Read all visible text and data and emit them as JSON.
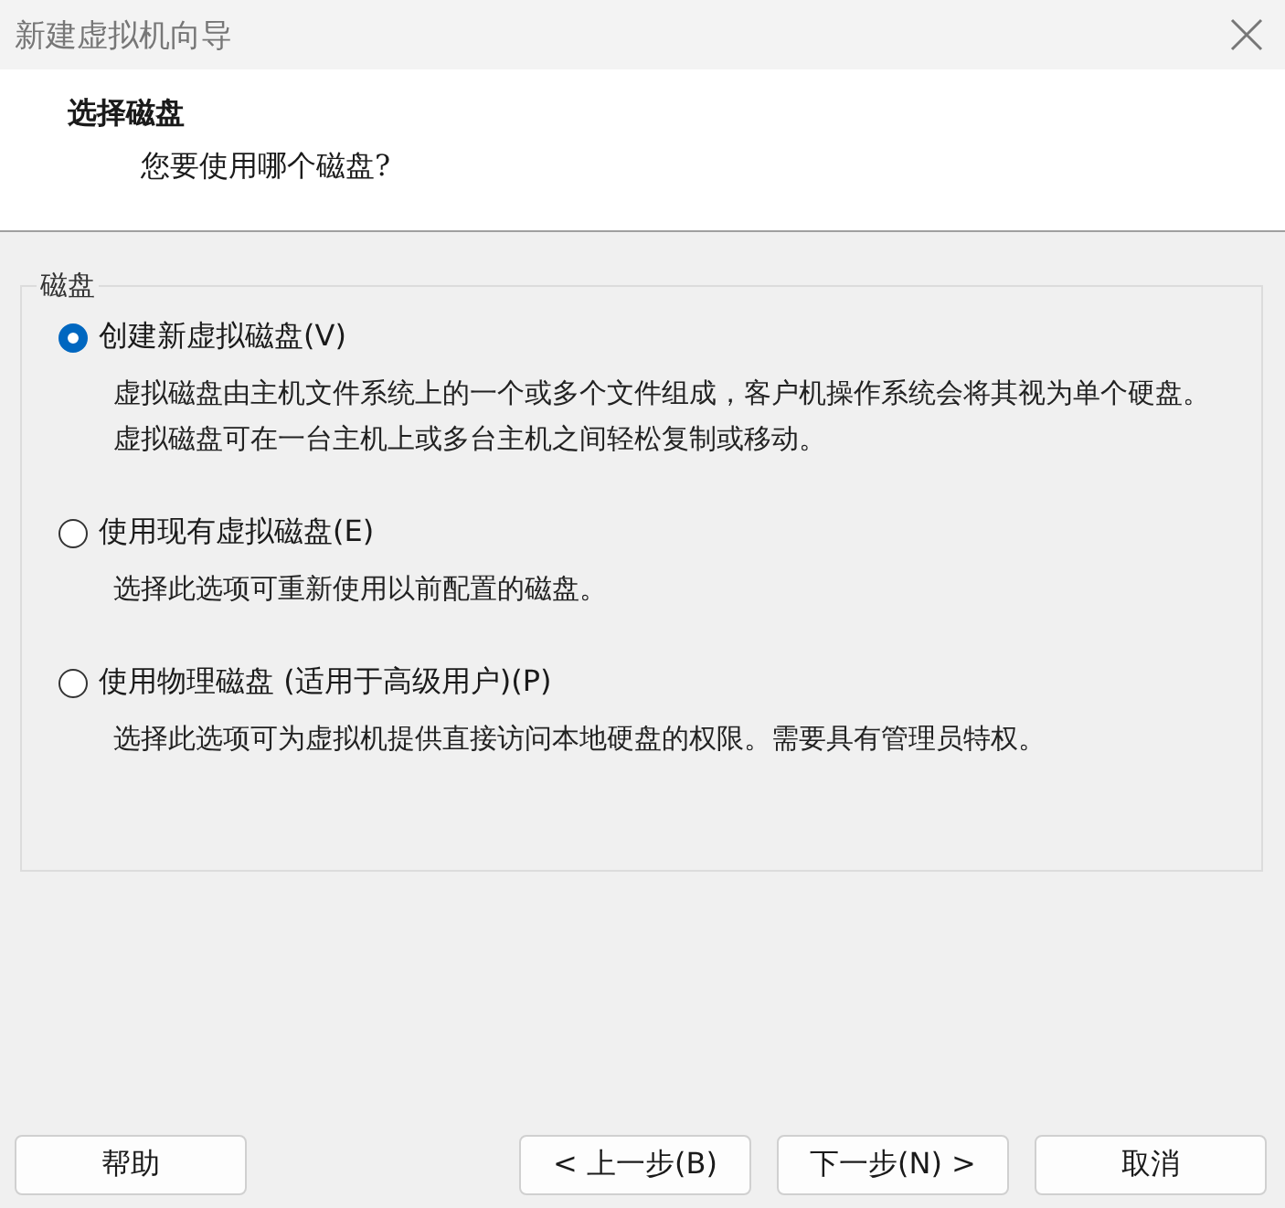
{
  "window": {
    "title": "新建虚拟机向导"
  },
  "header": {
    "title": "选择磁盘",
    "subtitle": "您要使用哪个磁盘?"
  },
  "group": {
    "label": "磁盘",
    "options": [
      {
        "label": "创建新虚拟磁盘(V)",
        "description": "虚拟磁盘由主机文件系统上的一个或多个文件组成，客户机操作系统会将其视为单个硬盘。虚拟磁盘可在一台主机上或多台主机之间轻松复制或移动。",
        "selected": true
      },
      {
        "label": "使用现有虚拟磁盘(E)",
        "description": "选择此选项可重新使用以前配置的磁盘。",
        "selected": false
      },
      {
        "label": "使用物理磁盘 (适用于高级用户)(P)",
        "description": "选择此选项可为虚拟机提供直接访问本地硬盘的权限。需要具有管理员特权。",
        "selected": false
      }
    ]
  },
  "buttons": {
    "help": "帮助",
    "back": "< 上一步(B)",
    "next": "下一步(N) >",
    "cancel": "取消"
  }
}
